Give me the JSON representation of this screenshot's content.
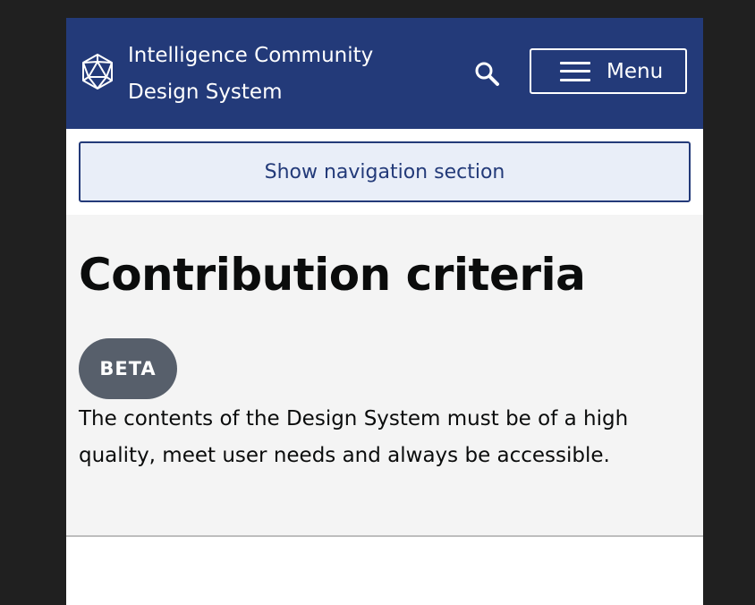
{
  "header": {
    "site_title_line1": "Intelligence Community",
    "site_title_line2": "Design System",
    "menu_label": "Menu",
    "icons": {
      "logo": "icosahedron-logo-icon",
      "search": "search-icon",
      "menu": "hamburger-icon"
    }
  },
  "nav": {
    "toggle_label": "Show navigation section"
  },
  "content": {
    "title": "Contribution criteria",
    "badge": "BETA",
    "lead": "The contents of the Design System must be of a high quality, meet user needs and always be accessible."
  },
  "colors": {
    "header_bg": "#233a79",
    "nav_toggle_bg": "#e9eef8",
    "hero_bg": "#f4f4f4",
    "badge_bg": "#575f6b",
    "frame_bg": "#202020"
  }
}
